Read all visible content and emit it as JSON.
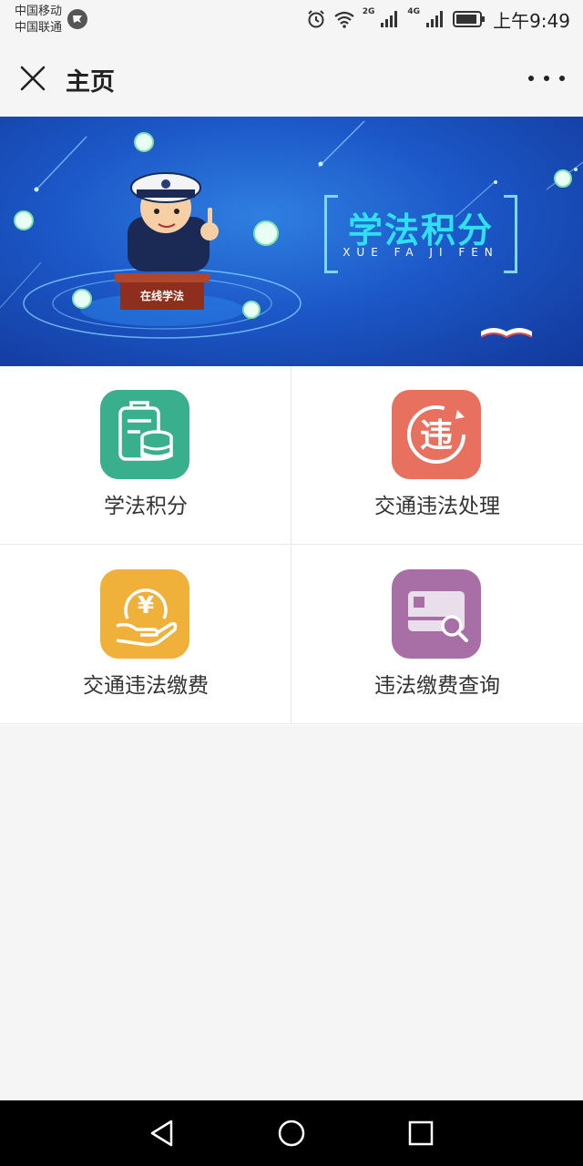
{
  "status_bar": {
    "carrier_1": "中国移动",
    "carrier_2": "中国联通",
    "net_1": "2G",
    "net_2": "4G",
    "time": "上午9:49",
    "icons": [
      "hotspot-icon",
      "alarm-icon",
      "wifi-icon",
      "signal-icon",
      "battery-icon"
    ]
  },
  "nav": {
    "title": "主页",
    "close_icon": "close-icon",
    "more_icon": "more-icon"
  },
  "banner": {
    "title": "学法积分",
    "subtitle": "XUE FA JI FEN",
    "podium_label": "在线学法"
  },
  "menu": [
    {
      "label": "学法积分",
      "icon": "points-icon",
      "color": "#3aaf8e"
    },
    {
      "label": "交通违法处理",
      "icon": "violation-icon",
      "color": "#e8705f"
    },
    {
      "label": "交通违法缴费",
      "icon": "payment-icon",
      "color": "#f0b13a"
    },
    {
      "label": "违法缴费查询",
      "icon": "card-search-icon",
      "color": "#a86fa6"
    }
  ],
  "system_nav": {
    "back": "back-icon",
    "home": "home-icon",
    "recents": "recents-icon"
  },
  "colors": {
    "background": "#f5f5f5",
    "banner_blue": "#1c58c8",
    "banner_title": "#2ee0f0"
  }
}
